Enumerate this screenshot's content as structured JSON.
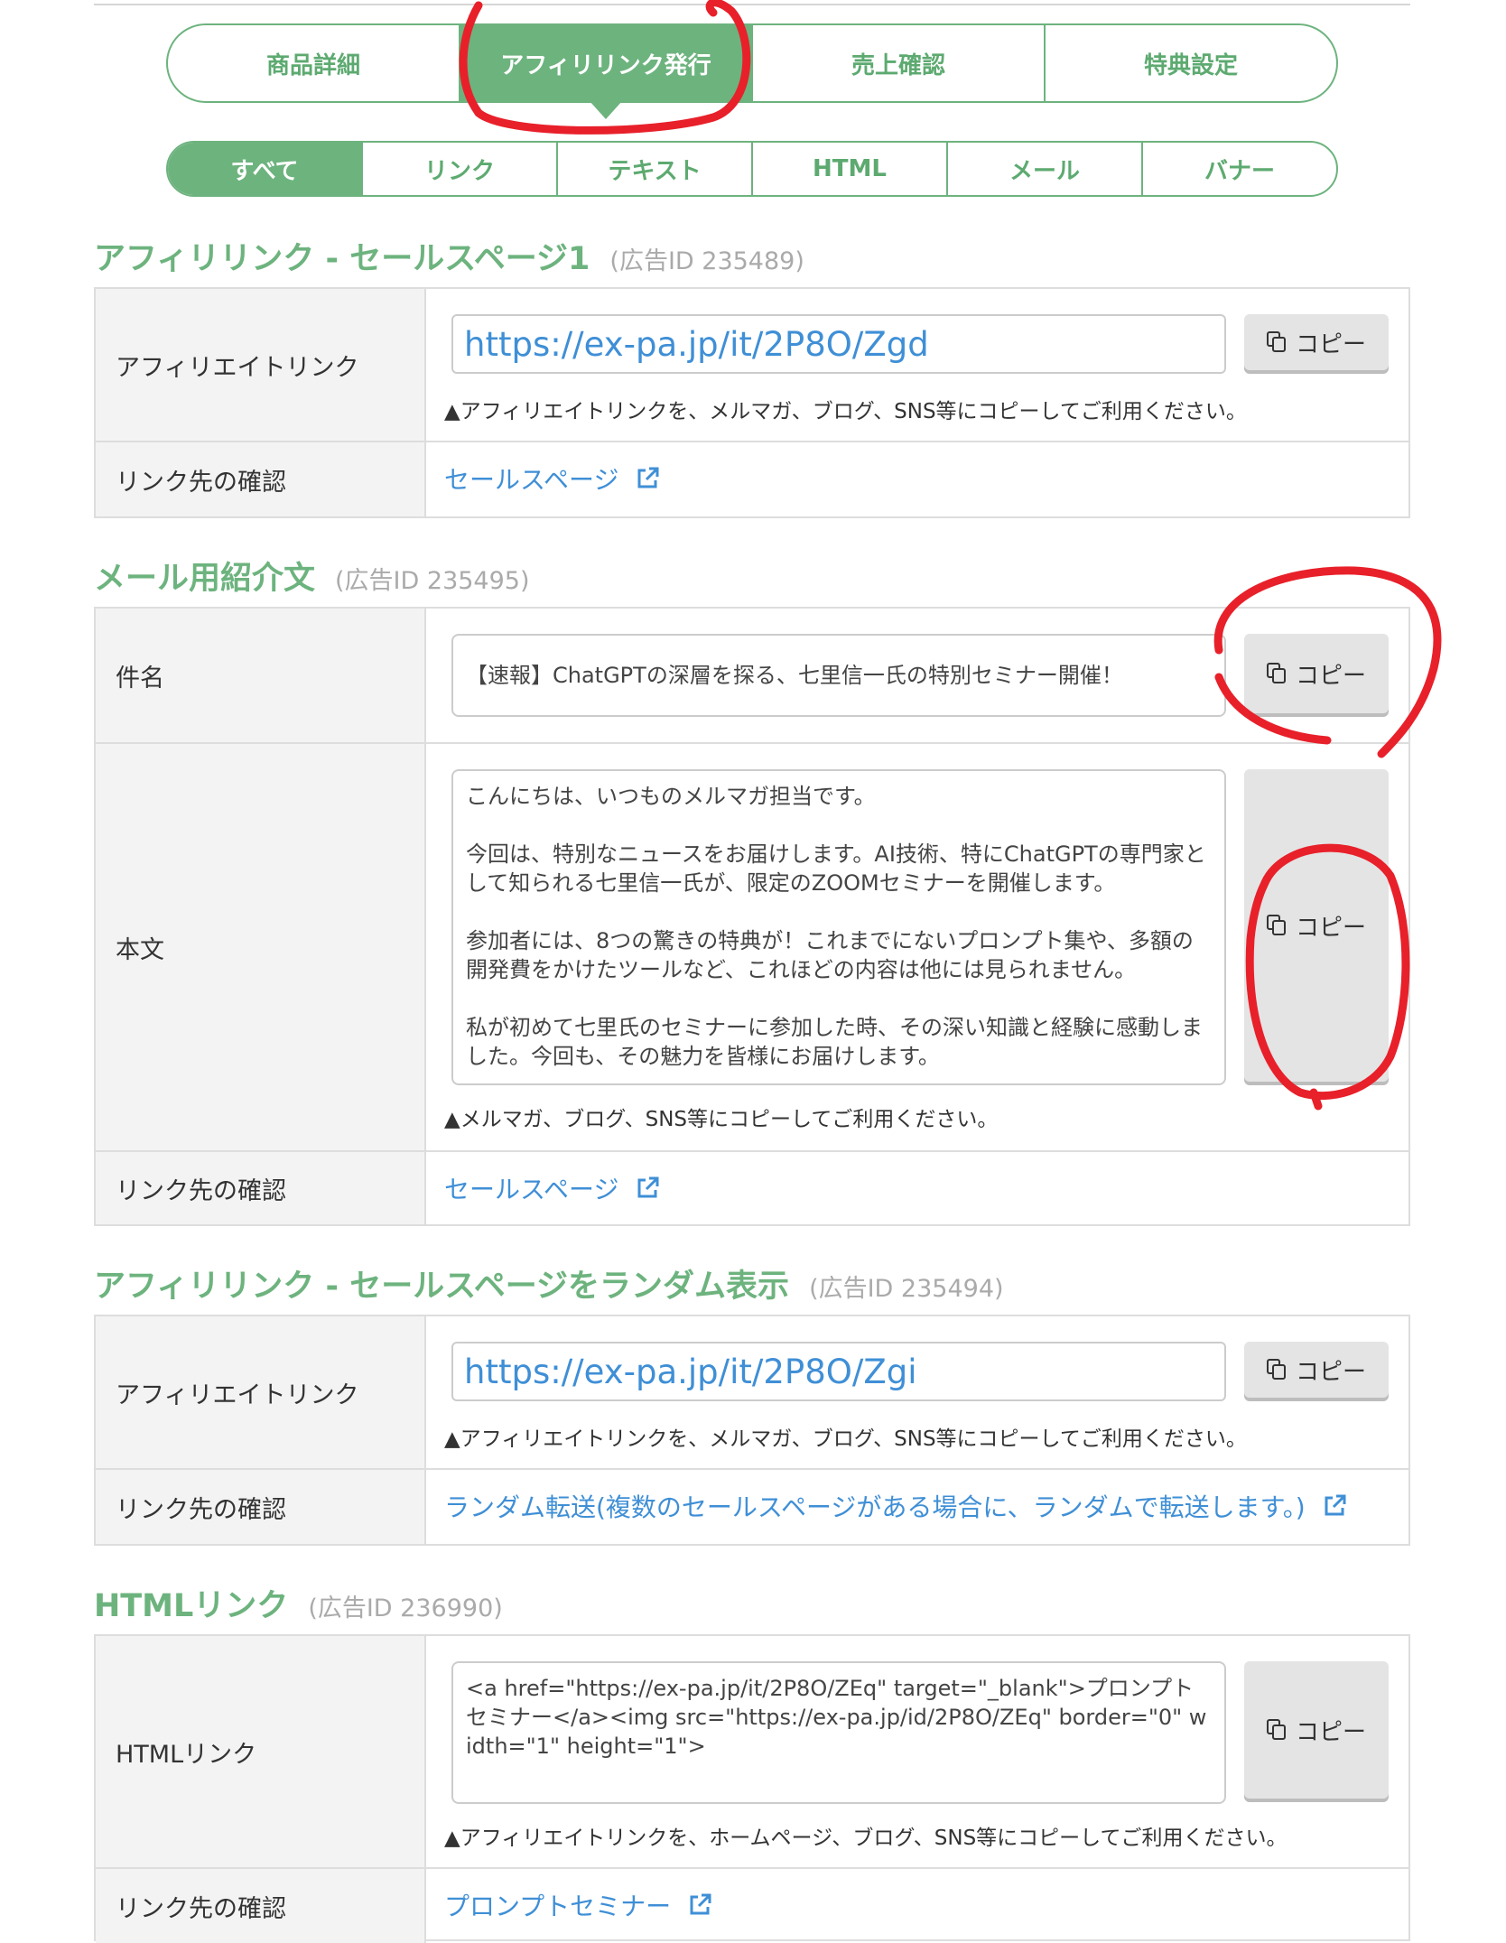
{
  "tabs_main": [
    {
      "label": "商品詳細",
      "active": false
    },
    {
      "label": "アフィリリンク発行",
      "active": true
    },
    {
      "label": "売上確認",
      "active": false
    },
    {
      "label": "特典設定",
      "active": false
    }
  ],
  "tabs_sub": [
    {
      "label": "すべて",
      "active": true
    },
    {
      "label": "リンク",
      "active": false
    },
    {
      "label": "テキスト",
      "active": false
    },
    {
      "label": "HTML",
      "active": false
    },
    {
      "label": "メール",
      "active": false
    },
    {
      "label": "バナー",
      "active": false
    }
  ],
  "copy_label": "コピー",
  "sections": {
    "link1": {
      "title": "アフィリリンク - セールスページ1",
      "ad_id": "(広告ID 235489)",
      "row1_label": "アフィリエイトリンク",
      "url": "https://ex-pa.jp/it/2P8O/Zgd",
      "note": "▲アフィリエイトリンクを、メルマガ、ブログ、SNS等にコピーしてご利用ください。",
      "row2_label": "リンク先の確認",
      "dest": "セールスページ"
    },
    "mail": {
      "title": "メール用紹介文",
      "ad_id": "(広告ID 235495)",
      "subject_label": "件名",
      "subject": "【速報】ChatGPTの深層を探る、七里信一氏の特別セミナー開催！",
      "body_label": "本文",
      "body": "こんにちは、いつものメルマガ担当です。\n\n今回は、特別なニュースをお届けします。AI技術、特にChatGPTの専門家として知られる七里信一氏が、限定のZOOMセミナーを開催します。\n\n参加者には、8つの驚きの特典が！これまでにないプロンプト集や、多額の開発費をかけたツールなど、これほどの内容は他には見られません。\n\n私が初めて七里氏のセミナーに参加した時、その深い知識と経験に感動しました。今回も、その魅力を皆様にお届けします。",
      "note": "▲メルマガ、ブログ、SNS等にコピーしてご利用ください。",
      "dest_label": "リンク先の確認",
      "dest": "セールスページ"
    },
    "random": {
      "title": "アフィリリンク - セールスページをランダム表示",
      "ad_id": "(広告ID 235494)",
      "row1_label": "アフィリエイトリンク",
      "url": "https://ex-pa.jp/it/2P8O/Zgi",
      "note": "▲アフィリエイトリンクを、メルマガ、ブログ、SNS等にコピーしてご利用ください。",
      "row2_label": "リンク先の確認",
      "dest": "ランダム転送(複数のセールスページがある場合に、ランダムで転送します。)"
    },
    "html": {
      "title": "HTMLリンク",
      "ad_id": "(広告ID 236990)",
      "row1_label": "HTMLリンク",
      "code": "<a href=\"https://ex-pa.jp/it/2P8O/ZEq\" target=\"_blank\">プロンプトセミナー</a><img src=\"https://ex-pa.jp/id/2P8O/ZEq\" border=\"0\" width=\"1\" height=\"1\">",
      "note": "▲アフィリエイトリンクを、ホームページ、ブログ、SNS等にコピーしてご利用ください。",
      "row2_label": "リンク先の確認",
      "dest": "プロンプトセミナー"
    }
  },
  "colors": {
    "accent": "#6db37e",
    "link": "#3f8fd6",
    "annotation": "#e8202a"
  }
}
